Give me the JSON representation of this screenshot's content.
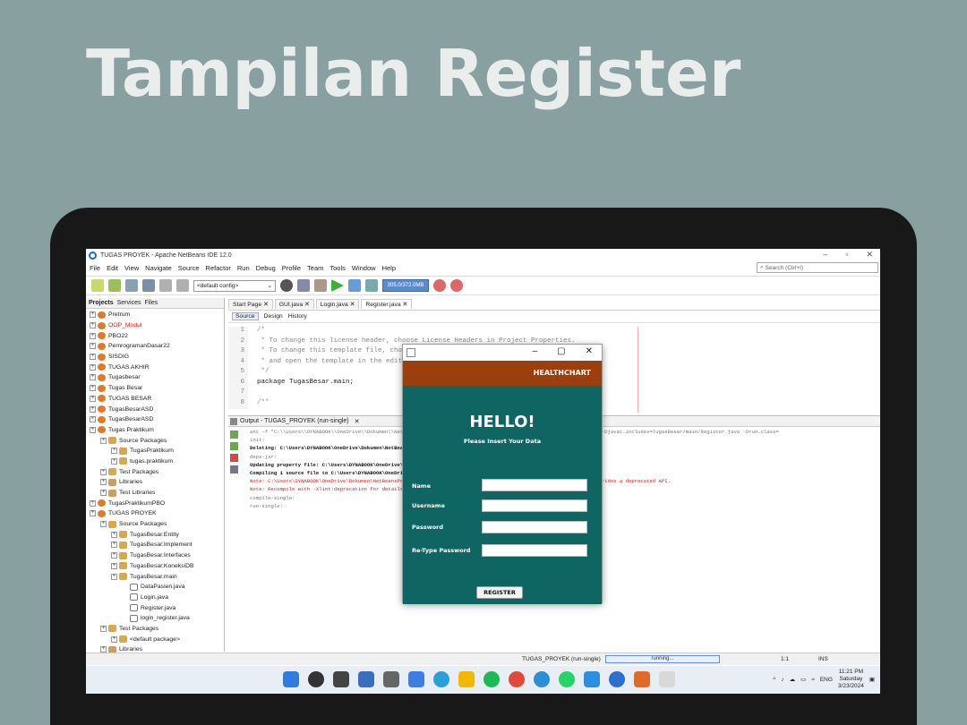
{
  "slide": {
    "title": "Tampilan Register"
  },
  "ide": {
    "window_title": "TUGAS PROYEK - Apache NetBeans IDE 12.0",
    "menu": [
      "File",
      "Edit",
      "View",
      "Navigate",
      "Source",
      "Refactor",
      "Run",
      "Debug",
      "Profile",
      "Team",
      "Tools",
      "Window",
      "Help"
    ],
    "search_placeholder": "Search (Ctrl+I)",
    "config": "<default config>",
    "memory": "305.0/372.0MB",
    "panel_tabs": [
      "Projects",
      "Services",
      "Files"
    ],
    "tree": [
      {
        "label": "Pretrum",
        "indent": 0,
        "icon": "proj"
      },
      {
        "label": "OOP_Modul",
        "indent": 0,
        "icon": "proj",
        "color": "#d02020"
      },
      {
        "label": "PBO22",
        "indent": 0,
        "icon": "proj"
      },
      {
        "label": "PemrogramanDasar22",
        "indent": 0,
        "icon": "proj"
      },
      {
        "label": "SISDIG",
        "indent": 0,
        "icon": "proj"
      },
      {
        "label": "TUGAS AKHIR",
        "indent": 0,
        "icon": "proj"
      },
      {
        "label": "Tugasbesar",
        "indent": 0,
        "icon": "proj"
      },
      {
        "label": "Tugas Besar",
        "indent": 0,
        "icon": "proj"
      },
      {
        "label": "TUGAS BESAR",
        "indent": 0,
        "icon": "proj"
      },
      {
        "label": "TugasBesarASD",
        "indent": 0,
        "icon": "proj"
      },
      {
        "label": "TugasBesarASD",
        "indent": 0,
        "icon": "proj"
      },
      {
        "label": "Tugas Praktikum",
        "indent": 0,
        "icon": "proj"
      },
      {
        "label": "Source Packages",
        "indent": 1,
        "icon": "pkg"
      },
      {
        "label": "TugasPraktikum",
        "indent": 2,
        "icon": "pkg"
      },
      {
        "label": "tugas.praktikum",
        "indent": 2,
        "icon": "pkg"
      },
      {
        "label": "Test Packages",
        "indent": 1,
        "icon": "pkg"
      },
      {
        "label": "Libraries",
        "indent": 1,
        "icon": "lib"
      },
      {
        "label": "Test Libraries",
        "indent": 1,
        "icon": "lib"
      },
      {
        "label": "TugasPraktikumPBO",
        "indent": 0,
        "icon": "proj"
      },
      {
        "label": "TUGAS PROYEK",
        "indent": 0,
        "icon": "proj"
      },
      {
        "label": "Source Packages",
        "indent": 1,
        "icon": "pkg"
      },
      {
        "label": "TugasBesar.Entity",
        "indent": 2,
        "icon": "pkg"
      },
      {
        "label": "TugasBesar.Implement",
        "indent": 2,
        "icon": "pkg"
      },
      {
        "label": "TugasBesar.Interfaces",
        "indent": 2,
        "icon": "pkg"
      },
      {
        "label": "TugasBesar.KoneksiDB",
        "indent": 2,
        "icon": "pkg"
      },
      {
        "label": "TugasBesar.main",
        "indent": 2,
        "icon": "pkg"
      },
      {
        "label": "DataPasien.java",
        "indent": 3,
        "icon": "file"
      },
      {
        "label": "Login.java",
        "indent": 3,
        "icon": "file"
      },
      {
        "label": "Register.java",
        "indent": 3,
        "icon": "file"
      },
      {
        "label": "login_register.java",
        "indent": 3,
        "icon": "file"
      },
      {
        "label": "Test Packages",
        "indent": 1,
        "icon": "pkg"
      },
      {
        "label": "<default package>",
        "indent": 2,
        "icon": "pkg"
      },
      {
        "label": "Libraries",
        "indent": 1,
        "icon": "lib"
      }
    ],
    "doc_tabs": [
      "Start Page",
      "GUI.java",
      "Login.java",
      "Register.java"
    ],
    "editor_tabs": [
      "Source",
      "Design",
      "History"
    ],
    "code": [
      {
        "n": "1",
        "t": "/*"
      },
      {
        "n": "2",
        "t": " * To change this license header, choose License Headers in Project Properties."
      },
      {
        "n": "3",
        "t": " * To change this template file, choose Tools | Templates"
      },
      {
        "n": "4",
        "t": " * and open the template in the editor."
      },
      {
        "n": "5",
        "t": " */"
      },
      {
        "n": "6",
        "t": "package TugasBesar.main;"
      },
      {
        "n": "7",
        "t": ""
      },
      {
        "n": "8",
        "t": "/**"
      }
    ],
    "output_tab": "Output - TUGAS_PROYEK (run-single)",
    "output_lines": [
      {
        "t": "ant -f \"C:\\\\Users\\\\DYNABOOK\\\\OneDrive\\\\Dokumen\\\\NetBeansProjects\\\\TUGAS PROYEK\" -Dnb.internal.action.name=run.single -Djavac.includes=TugasBesar/main/Register.java -Drun.class=",
        "k": "grey"
      },
      {
        "t": "init:",
        "k": "grey"
      },
      {
        "t": "Deleting: C:\\Users\\DYNABOOK\\OneDrive\\Dokumen\\NetBeansProjects\\TUGAS PROYEK\\build\\built-jar.properties   classes",
        "k": "bold"
      },
      {
        "t": "deps-jar:",
        "k": "grey"
      },
      {
        "t": "Updating property file: C:\\Users\\DYNABOOK\\OneDrive\\Dokumen\\NetBeansProjects\\TUGAS PROYEK\\build\\built-jar.properties",
        "k": "bold"
      },
      {
        "t": "Compiling 1 source file to C:\\Users\\DYNABOOK\\OneDrive\\Dokumen\\NetBeansProjects\\TUGAS PROYEK\\build\\classes",
        "k": "bold"
      },
      {
        "t": "Note: C:\\Users\\DYNABOOK\\OneDrive\\Dokumen\\NetBeansProjects\\TUGAS PROYEK\\src\\TugasBesar\\main\\Register.java uses or overrides a deprecated API.",
        "k": "err"
      },
      {
        "t": "Note: Recompile with -Xlint:deprecation for details.",
        "k": "err"
      },
      {
        "t": "compile-single:",
        "k": "grey"
      },
      {
        "t": "run-single:",
        "k": "grey"
      }
    ],
    "status": {
      "task": "TUGAS_PROYEK (run-single)",
      "progress": "running...",
      "position": "1:1",
      "mode": "INS"
    },
    "clock": {
      "time": "11:21 PM",
      "day": "Saturday",
      "date": "3/23/2024"
    },
    "lang": "ENG"
  },
  "dialog": {
    "brand": "HEALTHCHART",
    "hello": "HELLO!",
    "subtitle": "Please Insert Your Data",
    "fields": {
      "name": "Name",
      "username": "Username",
      "password": "Password",
      "retype": "Re-Type Password"
    },
    "button": "REGISTER"
  },
  "colors": {
    "slide_bg": "#88a09f",
    "dialog_header": "#9b3f0e",
    "dialog_body": "#0e6561"
  }
}
